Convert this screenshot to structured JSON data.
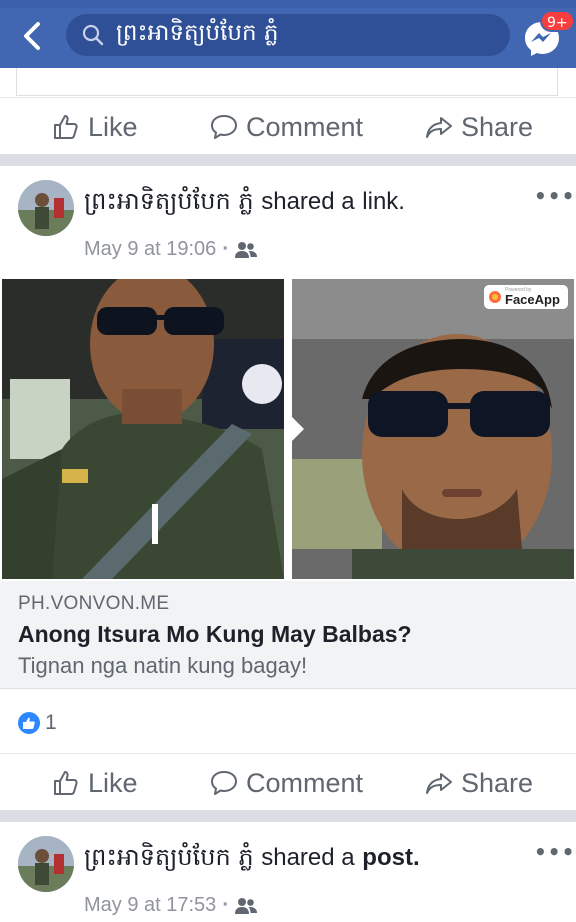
{
  "search": {
    "query": "ព្រះអាទិត្យបំបែក ភ្លំ"
  },
  "notifications": {
    "messenger_badge": "9+"
  },
  "actions": {
    "like": "Like",
    "comment": "Comment",
    "share": "Share"
  },
  "posts": [
    {
      "author": "ព្រះអាទិត្យបំបែក ភ្លំ",
      "verb": "shared a",
      "object": "link.",
      "timestamp": "May 9 at 19:06",
      "separator": "·",
      "audience_icon": "friends-icon",
      "watermark": "FaceApp",
      "watermark_small": "Powered by",
      "link": {
        "domain": "PH.VONVON.ME",
        "title": "Anong Itsura Mo Kung May Balbas?",
        "description": "Tignan nga natin kung bagay!"
      },
      "reaction_count": "1"
    },
    {
      "author": "ព្រះអាទិត្យបំបែក ភ្លំ",
      "verb": "shared a",
      "object": "post.",
      "timestamp": "May 9 at 17:53",
      "separator": "·",
      "audience_icon": "friends-icon"
    }
  ],
  "more_label": "•••",
  "colors": {
    "brand": "#4267b2",
    "like_blue": "#2d88ff",
    "muted": "#606770"
  }
}
